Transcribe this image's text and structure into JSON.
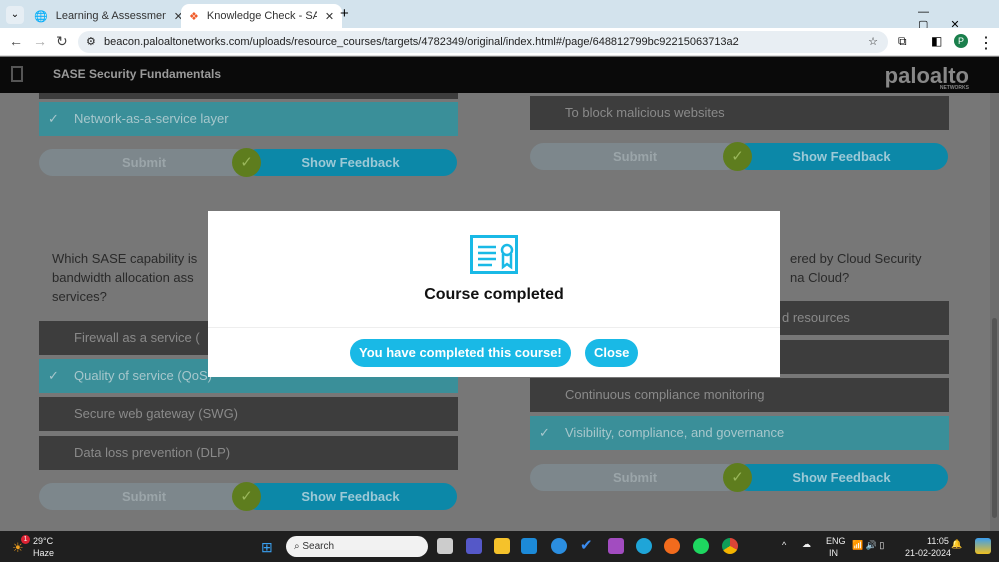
{
  "browser": {
    "tabs": [
      {
        "title": "Learning & Assessment Platform",
        "active": false
      },
      {
        "title": "Knowledge Check - SASE Security Fundamentals",
        "active": true
      }
    ],
    "url": "beacon.paloaltonetworks.com/uploads/resource_courses/targets/4782349/original/index.html#/page/648812799bc92215063713a2",
    "profile": "P"
  },
  "app": {
    "title": "SASE Security Fundamentals",
    "logo": "paloalto",
    "logo_sub": "NETWORKS"
  },
  "q1": {
    "options": [
      "Network-as-a-service layer"
    ]
  },
  "q2": {
    "options": [
      "To block malicious websites"
    ]
  },
  "q3": {
    "question": "Which SASE capability is used to prioritize bandwidth allocation associated with specific applications or services?",
    "question_visible": [
      "Which SASE capability is",
      "bandwidth allocation ass",
      "services?"
    ],
    "options": [
      "Firewall as a service (",
      "Quality of service (QoS)",
      "Secure web gateway (SWG)",
      "Data loss prevention (DLP)"
    ]
  },
  "q4": {
    "question_visible": [
      "ered by Cloud Security",
      "na Cloud?"
    ],
    "options": [
      "d resources",
      "",
      "Continuous compliance monitoring",
      "Visibility, compliance, and governance"
    ]
  },
  "buttons": {
    "submit": "Submit",
    "feedback": "Show Feedback"
  },
  "modal": {
    "title": "Course completed",
    "primary": "You have completed this course!",
    "close": "Close"
  },
  "taskbar": {
    "temp": "29°C",
    "weather": "Haze",
    "badge": "1",
    "search": "Search",
    "lang1": "ENG",
    "lang2": "IN",
    "time": "11:05",
    "date": "21-02-2024"
  }
}
